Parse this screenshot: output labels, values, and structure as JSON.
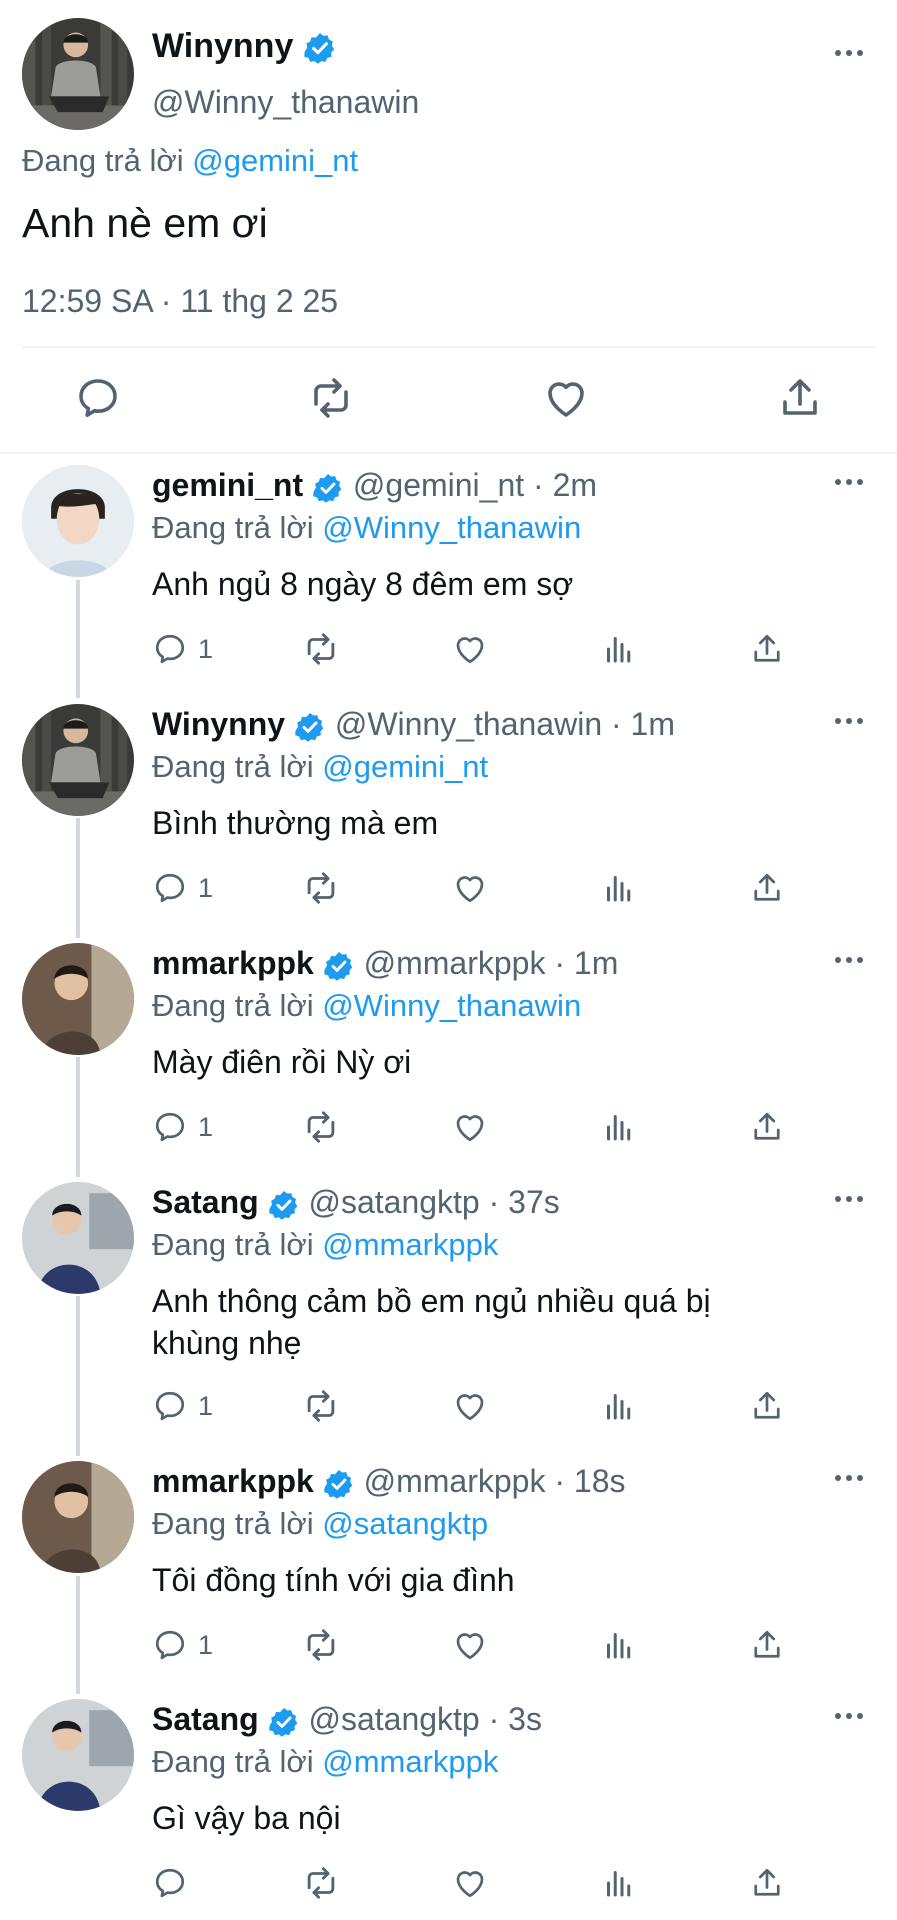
{
  "main_tweet": {
    "display_name": "Winynny",
    "handle": "@Winny_thanawin",
    "reply_prefix": "Đang trả lời",
    "reply_to": "@gemini_nt",
    "text": "Anh nè em ơi",
    "timestamp": "12:59 SA · 11 thg 2 25"
  },
  "colors": {
    "accent": "#1d9bf0",
    "muted": "#536471",
    "text": "#0f1419",
    "divider": "#eff3f4"
  },
  "replies": [
    {
      "name": "gemini_nt",
      "handle": "@gemini_nt",
      "time": "· 2m",
      "reply_prefix": "Đang trả lời",
      "reply_to": "@Winny_thanawin",
      "text": "Anh ngủ 8 ngày 8 đêm em sợ",
      "reply_count": "1"
    },
    {
      "name": "Winynny",
      "handle": "@Winny_thanawin",
      "time": "· 1m",
      "reply_prefix": "Đang trả lời",
      "reply_to": "@gemini_nt",
      "text": "Bình thường mà em",
      "reply_count": "1"
    },
    {
      "name": "mmarkppk",
      "handle": "@mmarkppk",
      "time": "· 1m",
      "reply_prefix": "Đang trả lời",
      "reply_to": "@Winny_thanawin",
      "text": "Mày điên rồi Nỳ ơi",
      "reply_count": "1"
    },
    {
      "name": "Satang",
      "handle": "@satangktp",
      "time": "· 37s",
      "reply_prefix": "Đang trả lời",
      "reply_to": "@mmarkppk",
      "text": "Anh thông cảm bồ em ngủ nhiều quá bị khùng nhẹ",
      "reply_count": "1"
    },
    {
      "name": "mmarkppk",
      "handle": "@mmarkppk",
      "time": "· 18s",
      "reply_prefix": "Đang trả lời",
      "reply_to": "@satangktp",
      "text": "Tôi đồng tính với gia đình",
      "reply_count": "1"
    },
    {
      "name": "Satang",
      "handle": "@satangktp",
      "time": "· 3s",
      "reply_prefix": "Đang trả lời",
      "reply_to": "@mmarkppk",
      "text": "Gì vậy ba nội",
      "reply_count": ""
    }
  ],
  "icons": [
    "reply-icon",
    "retweet-icon",
    "like-icon",
    "views-icon",
    "share-icon",
    "more-icon",
    "verified-badge-icon"
  ]
}
